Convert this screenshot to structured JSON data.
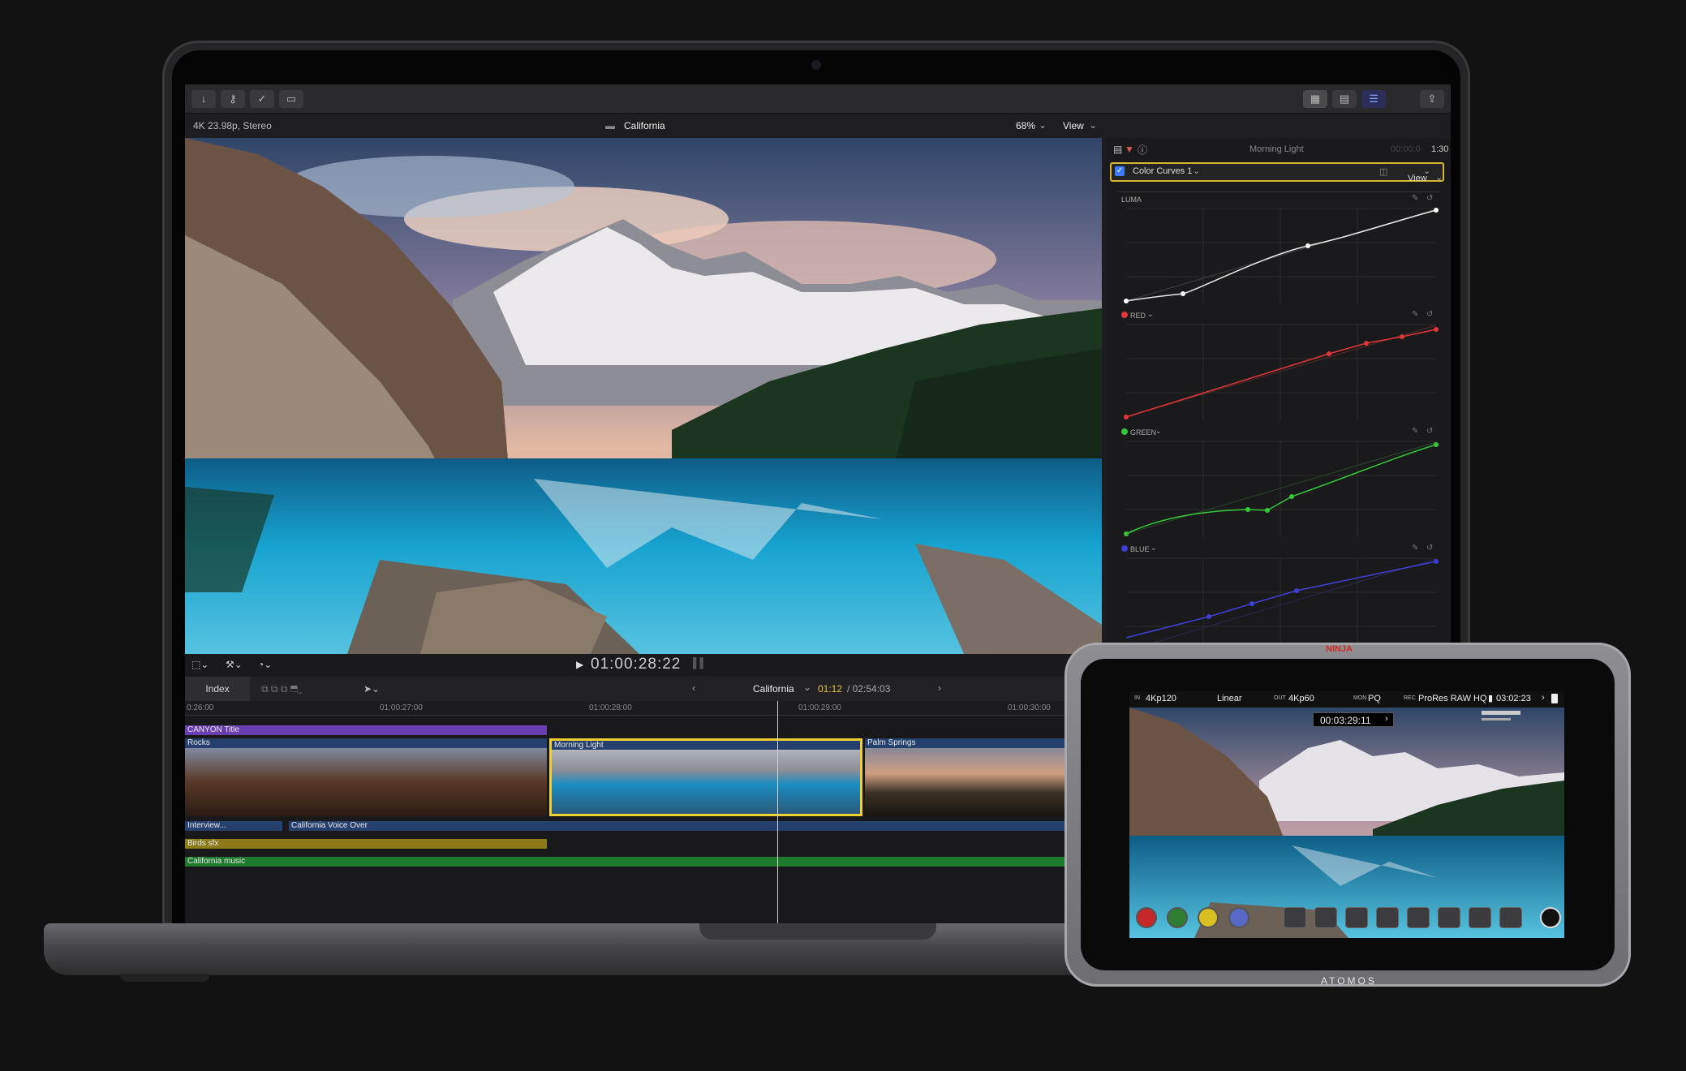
{
  "toolbar": {
    "buttons": [
      "import-icon",
      "keyword-icon",
      "check-icon",
      "tag-icon"
    ],
    "right_buttons": [
      "browser-grid-icon",
      "filmstrip-icon",
      "inspector-icon",
      "share-icon"
    ]
  },
  "viewer": {
    "format": "4K 23.98p, Stereo",
    "title": "California",
    "zoom": "68%",
    "view_label": "View",
    "timecode": "01:00:28:22"
  },
  "inspector": {
    "clip_name": "Morning Light",
    "duration": "1:30",
    "duration_prefix": "00:00:0",
    "effect_name": "Color Curves 1",
    "view_label": "View",
    "curves": [
      {
        "name": "LUMA",
        "color": "#e8e8e8"
      },
      {
        "name": "RED",
        "color": "#e0363b"
      },
      {
        "name": "GREEN",
        "color": "#35c83a"
      },
      {
        "name": "BLUE",
        "color": "#3f3fd8"
      }
    ]
  },
  "timeline": {
    "index_label": "Index",
    "project": "California",
    "position": "01:12",
    "duration": "/ 02:54:03",
    "ruler": [
      "0:26:00",
      "01:00:27:00",
      "01:00:28:00",
      "01:00:29:00",
      "01:00:30:00"
    ],
    "clips": {
      "title": "CANYON Title",
      "rocks": "Rocks",
      "morning": "Morning Light",
      "palm": "Palm Springs",
      "interview": "Interview...",
      "voiceover": "California Voice Over",
      "birds": "Birds sfx",
      "music": "California music"
    },
    "colors": {
      "title": "#6a3fb0",
      "audio_blue": "#26406e",
      "birds": "#8a7a18",
      "music": "#1e7a2c",
      "selection": "#f0d030"
    }
  },
  "atomos": {
    "brand": "ATOMOS",
    "top_brand": "NINJA",
    "hud": {
      "in_label": "IN",
      "in_format": "4Kp120",
      "gamma": "Linear",
      "out_label": "OUT",
      "out_format": "4Kp60",
      "mon_label": "MON",
      "mon_value": "PQ",
      "rec_label": "REC",
      "codec": "ProRes RAW HQ",
      "remaining": "03:02:23",
      "timecode": "00:03:29:11"
    }
  }
}
